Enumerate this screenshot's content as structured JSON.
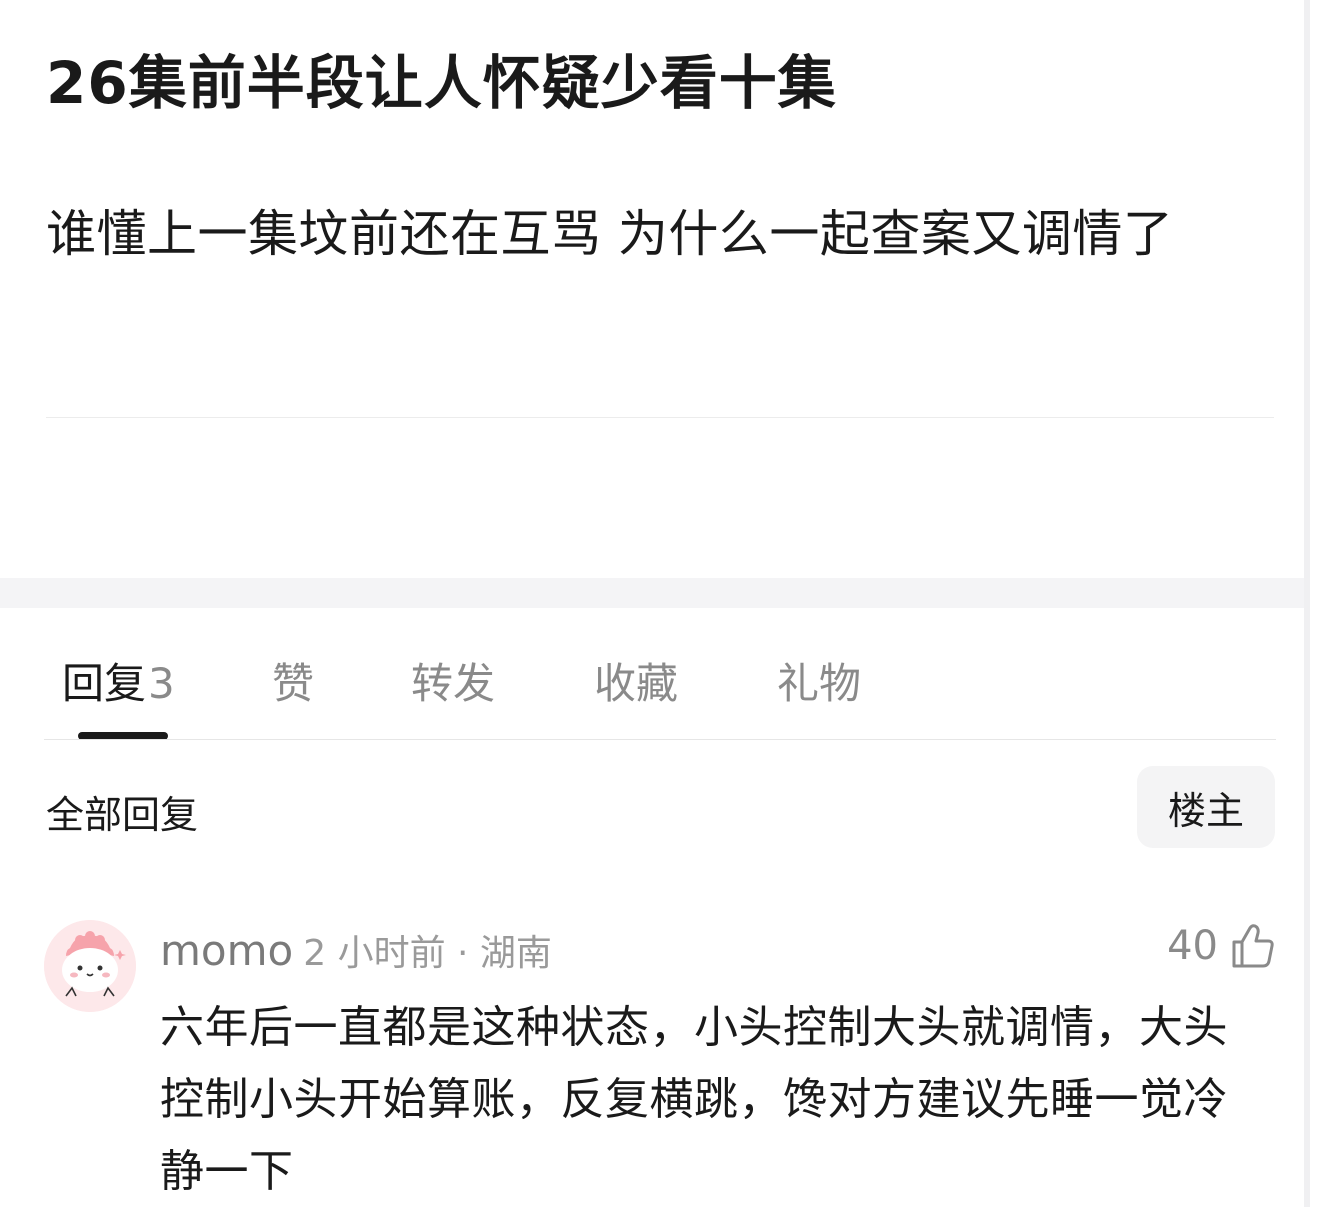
{
  "post": {
    "title": "26集前半段让人怀疑少看十集",
    "body": "谁懂上一集坟前还在互骂 为什么一起查案又调情了"
  },
  "tabs": [
    {
      "label": "回复",
      "count": "3",
      "active": true
    },
    {
      "label": "赞",
      "active": false
    },
    {
      "label": "转发",
      "active": false
    },
    {
      "label": "收藏",
      "active": false
    },
    {
      "label": "礼物",
      "active": false
    }
  ],
  "replies": {
    "filter_label": "全部回复",
    "op_filter_label": "楼主"
  },
  "comments": [
    {
      "username": "momo",
      "time_location": "2 小时前 · 湖南",
      "likes": "40",
      "text": "六年后一直都是这种状态，小头控制大头就调情，大头控制小头开始算账，反复横跳，馋对方建议先睡一觉冷静一下",
      "avatar_icon": "cartoon-avatar-icon"
    }
  ],
  "colors": {
    "accent": "#1a1a1a",
    "muted": "#8a8a8a",
    "section_bg": "#f4f4f6",
    "avatar_bg": "#fde8ea"
  }
}
